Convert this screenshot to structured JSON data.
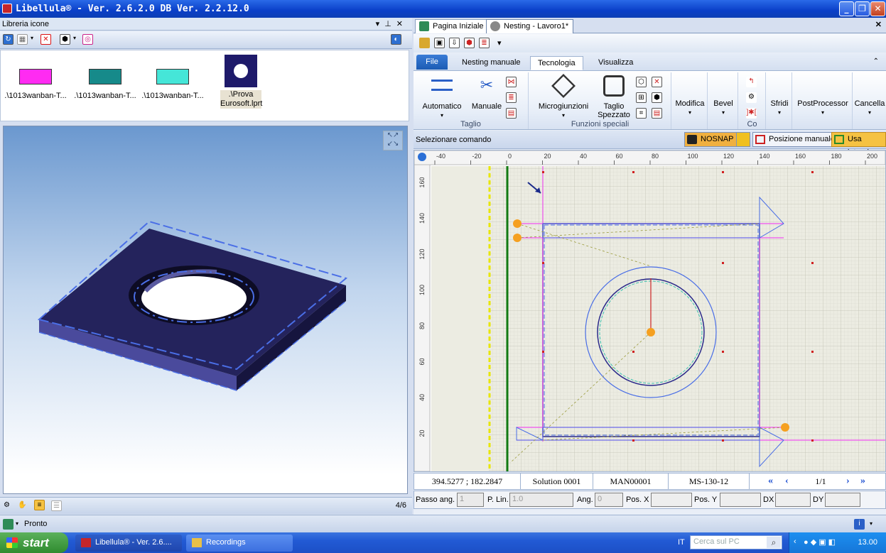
{
  "window": {
    "title": "Libellula® - Ver. 2.6.2.0 DB Ver. 2.2.12.0"
  },
  "library": {
    "title": "Libreria icone",
    "items": [
      {
        "label": ".\\1013wanban-T...",
        "color": "#ff2bf2"
      },
      {
        "label": ".\\1013wanban-T...",
        "color": "#168a8a"
      },
      {
        "label": ".\\1013wanban-T...",
        "color": "#45e6d8"
      },
      {
        "label": ".\\Prova Eurosoft.lprt",
        "color": "#1e1a6a"
      }
    ],
    "page_counter": "4/6"
  },
  "tabs": [
    {
      "label": "Pagina Iniziale",
      "icon": "home-icon"
    },
    {
      "label": "Nesting - Lavoro1*",
      "icon": "nesting-icon"
    }
  ],
  "ribbon": {
    "file_label": "File",
    "tabs": [
      "Nesting manuale",
      "Tecnologia",
      "Visualizza"
    ],
    "active_tab": "Tecnologia",
    "buttons": {
      "automatico": "Automatico",
      "manuale": "Manuale",
      "microgiunzioni": "Microgiunzioni",
      "taglio_spezzato": "Taglio Spezzato",
      "modifica": "Modifica",
      "bevel": "Bevel",
      "sfridi": "Sfridi",
      "postprocessor": "PostProcessor",
      "cancella": "Cancella"
    },
    "groups": {
      "taglio": "Taglio",
      "funzioni_speciali": "Funzioni speciali",
      "co": "Co"
    }
  },
  "command": {
    "prompt": "Selezionare comando",
    "nosnap": "NOSNAP",
    "posizione_manuale": "Posizione manuale",
    "usa_interni": "Usa interni"
  },
  "ruler": {
    "x_ticks": [
      "-40",
      "-20",
      "0",
      "20",
      "40",
      "60",
      "80",
      "100",
      "120",
      "140",
      "160",
      "180",
      "200"
    ],
    "y_ticks": [
      "160",
      "140",
      "120",
      "100",
      "80",
      "60",
      "40",
      "20"
    ]
  },
  "status": {
    "coords": "394.5277 ; 182.2847",
    "solution": "Solution 0001",
    "man": "MAN00001",
    "ms": "MS-130-12",
    "page": "1/1"
  },
  "inputs": {
    "passo_ang_label": "Passo ang.",
    "passo_ang_value": "1",
    "p_lin_label": "P. Lin.",
    "p_lin_value": "1.0",
    "ang_label": "Ang.",
    "ang_value": "0",
    "pos_x_label": "Pos. X",
    "pos_y_label": "Pos. Y",
    "dx_label": "DX",
    "dy_label": "DY"
  },
  "statusbar": {
    "text": "Pronto"
  },
  "taskbar": {
    "start": "start",
    "tasks": [
      {
        "label": "Libellula® - Ver. 2.6....",
        "icon": "libellula-icon"
      },
      {
        "label": "Recordings",
        "icon": "folder-icon"
      }
    ],
    "lang": "IT",
    "search_placeholder": "Cerca sul PC",
    "clock": "13.00"
  }
}
